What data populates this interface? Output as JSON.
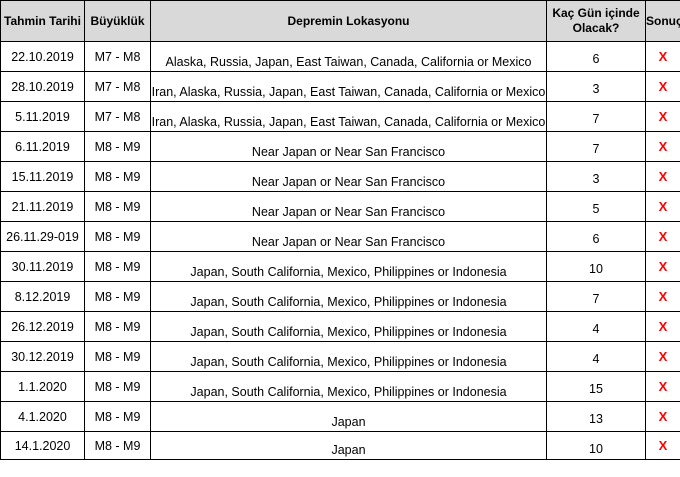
{
  "headers": [
    "Tahmin Tarihi",
    "Büyüklük",
    "Depremin Lokasyonu",
    "Kaç Gün içinde Olacak?",
    "Sonuç"
  ],
  "rows": [
    {
      "date": "22.10.2019",
      "mag": "M7 - M8",
      "loc": "Alaska, Russia, Japan, East Taiwan, Canada, California or Mexico",
      "days": "6",
      "result": "X"
    },
    {
      "date": "28.10.2019",
      "mag": "M7 - M8",
      "loc": "Iran, Alaska, Russia, Japan, East Taiwan, Canada, California or Mexico",
      "days": "3",
      "result": "X"
    },
    {
      "date": "5.11.2019",
      "mag": "M7 - M8",
      "loc": "Iran, Alaska, Russia, Japan, East Taiwan, Canada, California or Mexico",
      "days": "7",
      "result": "X"
    },
    {
      "date": "6.11.2019",
      "mag": "M8 - M9",
      "loc": "Near Japan or Near San Francisco",
      "days": "7",
      "result": "X"
    },
    {
      "date": "15.11.2019",
      "mag": "M8 - M9",
      "loc": "Near Japan or Near San Francisco",
      "days": "3",
      "result": "X"
    },
    {
      "date": "21.11.2019",
      "mag": "M8 - M9",
      "loc": "Near Japan or Near San Francisco",
      "days": "5",
      "result": "X"
    },
    {
      "date": "26.11.29-019",
      "mag": "M8 - M9",
      "loc": "Near Japan or Near San Francisco",
      "days": "6",
      "result": "X"
    },
    {
      "date": "30.11.2019",
      "mag": "M8 - M9",
      "loc": "Japan, South California, Mexico, Philippines or Indonesia",
      "days": "10",
      "result": "X"
    },
    {
      "date": "8.12.2019",
      "mag": "M8 - M9",
      "loc": "Japan, South California, Mexico, Philippines or Indonesia",
      "days": "7",
      "result": "X"
    },
    {
      "date": "26.12.2019",
      "mag": "M8 - M9",
      "loc": "Japan, South California, Mexico, Philippines or Indonesia",
      "days": "4",
      "result": "X"
    },
    {
      "date": "30.12.2019",
      "mag": "M8 - M9",
      "loc": "Japan, South California, Mexico, Philippines or Indonesia",
      "days": "4",
      "result": "X"
    },
    {
      "date": "1.1.2020",
      "mag": "M8 - M9",
      "loc": "Japan, South California, Mexico, Philippines or Indonesia",
      "days": "15",
      "result": "X"
    },
    {
      "date": "4.1.2020",
      "mag": "M8 - M9",
      "loc": "Japan",
      "days": "13",
      "result": "X"
    },
    {
      "date": "14.1.2020",
      "mag": "M8 - M9",
      "loc": "Japan",
      "days": "10",
      "result": "X"
    }
  ],
  "colors": {
    "header_bg": "#d9d9d9",
    "result": "#ff0000",
    "border": "#000000"
  }
}
